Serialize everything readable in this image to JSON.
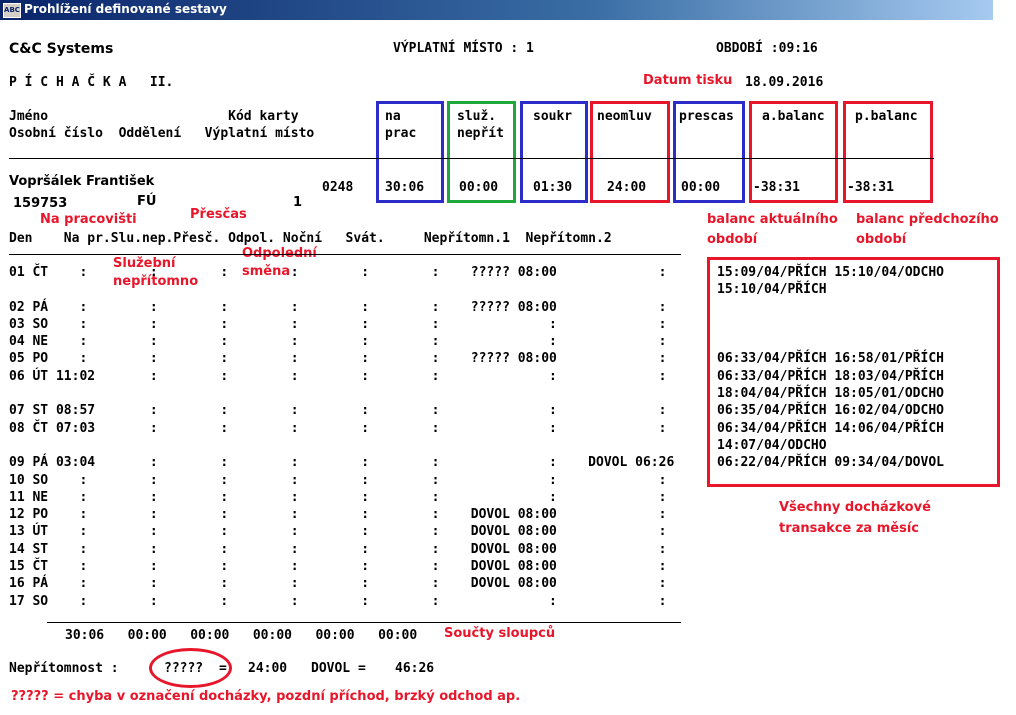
{
  "window": {
    "icon": "ABC",
    "title": "Prohlížení definované sestavy"
  },
  "header": {
    "company": "C&C Systems",
    "pay_point": "VÝPLATNÍ MÍSTO : 1",
    "period": "OBDOBÍ :09:16",
    "report_name": "P Í C H A Č K A   II.",
    "print_date_label": "Datum tisku",
    "print_date_value": "18.09.2016"
  },
  "columns_header": {
    "row1": "Jméno                       Kód karty",
    "row2": "Osobní číslo  Oddělení   Výplatní místo",
    "boxes": [
      {
        "line1": "na",
        "line2": "prac"
      },
      {
        "line1": "služ.",
        "line2": "nepřít"
      },
      {
        "line1": "soukr",
        "line2": ""
      },
      {
        "line1": "neomluv",
        "line2": ""
      },
      {
        "line1": "prescas",
        "line2": ""
      },
      {
        "line1": "a.balanc",
        "line2": ""
      },
      {
        "line1": "p.balanc",
        "line2": ""
      }
    ]
  },
  "employee": {
    "name": "Vopršálek František",
    "personal_no": "159753",
    "department": "FÚ",
    "pay_point": "1",
    "card_code": "0248",
    "values": [
      "30:06",
      "00:00",
      "01:30",
      "24:00",
      "00:00",
      "-38:31",
      "-38:31"
    ]
  },
  "annotations": {
    "na_pracovisti": "Na pracovišti",
    "prescas": "Přesčas",
    "sluzebni_nepritomno": [
      "Služební",
      "nepřítomno"
    ],
    "odpoledni_smena": [
      "Odpolední",
      "směna"
    ],
    "balanc_aktualniho": [
      "balanc aktuálního",
      "období"
    ],
    "balanc_predchoziho": [
      "balanc předchozího",
      "období"
    ],
    "vsechny_transakce": [
      "Všechny docházkové",
      "transakce za měsíc"
    ],
    "soucty": "Součty sloupců",
    "chyba": "????? = chyba v označení docházky, pozdní příchod, brzký odchod ap."
  },
  "day_header": "Den    Na pr.Slu.nep.Přesč. Odpol. Noční   Svát.     Nepřítomn.1  Nepřítomn.2",
  "day_rows": [
    "01 ČT    :        :        :        :        :        :    ????? 08:00             :",
    "",
    "02 PÁ    :        :        :        :        :        :    ????? 08:00             :",
    "03 SO    :        :        :        :        :        :              :             :",
    "04 NE    :        :        :        :        :        :              :             :",
    "05 PO    :        :        :        :        :        :    ????? 08:00             :",
    "06 ÚT 11:02       :        :        :        :        :              :             :",
    "",
    "07 ST 08:57       :        :        :        :        :              :             :",
    "08 ČT 07:03       :        :        :        :        :              :             :",
    "",
    "09 PÁ 03:04       :        :        :        :        :              :    DOVOL 06:26",
    "10 SO    :        :        :        :        :        :              :             :",
    "11 NE    :        :        :        :        :        :              :             :",
    "12 PO    :        :        :        :        :        :    DOVOL 08:00             :",
    "13 ÚT    :        :        :        :        :        :    DOVOL 08:00             :",
    "14 ST    :        :        :        :        :        :    DOVOL 08:00             :",
    "15 ČT    :        :        :        :        :        :    DOVOL 08:00             :",
    "16 PÁ    :        :        :        :        :        :    DOVOL 08:00             :",
    "17 SO    :        :        :        :        :        :              :             :"
  ],
  "transactions": [
    "15:09/04/PŘÍCH 15:10/04/ODCHO",
    "15:10/04/PŘÍCH",
    "",
    "",
    "",
    "06:33/04/PŘÍCH 16:58/01/PŘÍCH",
    "06:33/04/PŘÍCH 18:03/04/PŘÍCH",
    "18:04/04/PŘÍCH 18:05/01/ODCHO",
    "06:35/04/PŘÍCH 16:02/04/ODCHO",
    "06:34/04/PŘÍCH 14:06/04/PŘÍCH",
    "14:07/04/ODCHO",
    "06:22/04/PŘÍCH 09:34/04/DOVOL"
  ],
  "totals": "30:06   00:00   00:00   00:00   00:00   00:00",
  "absence": {
    "label": "Nepřítomnost :",
    "code1": "?????",
    "eq1": "=",
    "value1": "24:00",
    "code2": "DOVOL =",
    "value2": "46:26"
  },
  "colors": {
    "red": "#e8162a",
    "blue": "#2c2cc8",
    "green": "#1ea83c"
  }
}
